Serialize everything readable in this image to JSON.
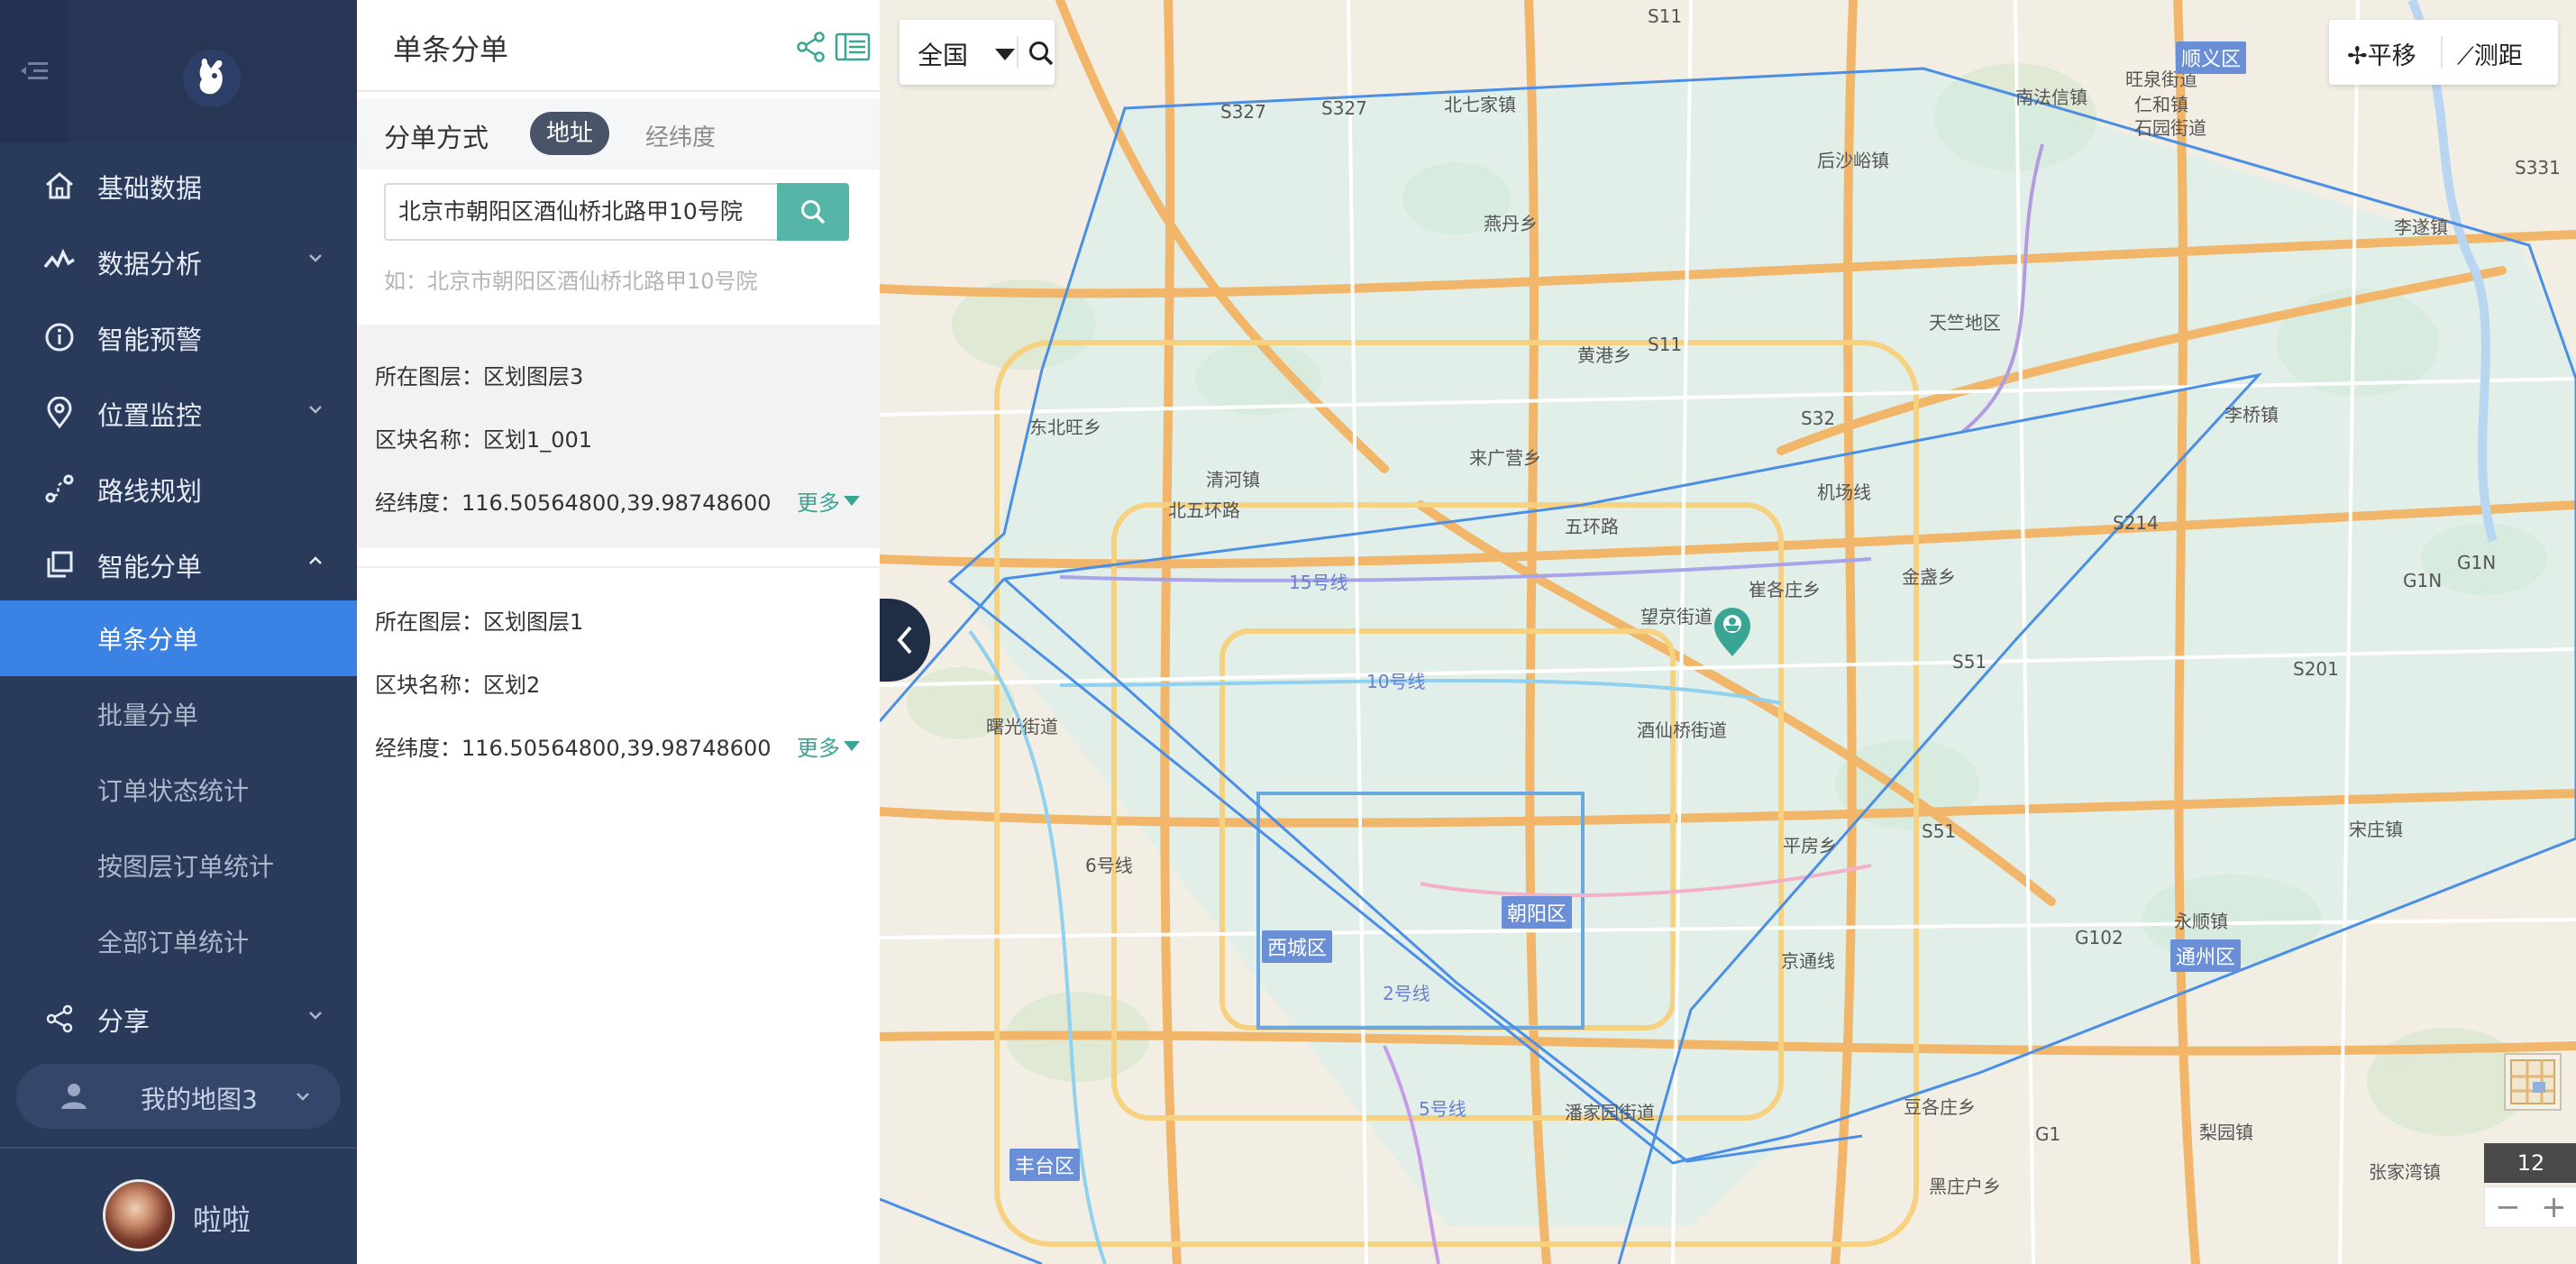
{
  "sidebar": {
    "nav": [
      {
        "label": "基础数据"
      },
      {
        "label": "数据分析"
      },
      {
        "label": "智能预警"
      },
      {
        "label": "位置监控"
      },
      {
        "label": "路线规划"
      },
      {
        "label": "智能分单"
      }
    ],
    "sub": [
      {
        "label": "单条分单"
      },
      {
        "label": "批量分单"
      },
      {
        "label": "订单状态统计"
      },
      {
        "label": "按图层订单统计"
      },
      {
        "label": "全部订单统计"
      }
    ],
    "share": {
      "label": "分享"
    },
    "my_map": {
      "label": "我的地图3"
    },
    "user": {
      "name": "啦啦"
    },
    "active_color": "#3a82e3",
    "bg_color": "#2a3a5a"
  },
  "panel": {
    "title": "单条分单",
    "mode_label": "分单方式",
    "mode_address": "地址",
    "mode_latlng": "经纬度",
    "search_value": "北京市朝阳区酒仙桥北路甲10号院",
    "search_hint": "如：北京市朝阳区酒仙桥北路甲10号院",
    "accent_color": "#55b5a6",
    "results": [
      {
        "layer": "所在图层：区划图层3",
        "block": "区块名称：区划1_001",
        "coords": "经纬度：116.50564800,39.98748600",
        "more": "更多"
      },
      {
        "layer": "所在图层：区划图层1",
        "block": "区块名称：区划2",
        "coords": "经纬度：116.50564800,39.98748600",
        "more": "更多"
      }
    ]
  },
  "map": {
    "region": "全国",
    "pan": "平移",
    "measure": "测距",
    "zoom_level": "12",
    "zoom_out": "−",
    "zoom_in": "+",
    "labels": [
      "北七家镇",
      "南法信镇",
      "旺泉街道",
      "顺义区",
      "仁和镇",
      "石园街道",
      "李遂镇",
      "后沙峪镇",
      "燕丹乡",
      "天竺地区",
      "黄港乡",
      "东北旺乡",
      "清河镇",
      "来广营乡",
      "李桥镇",
      "金盏乡",
      "崔各庄乡",
      "望京街道",
      "酒仙桥街道",
      "曙光街道",
      "平房乡",
      "宋庄镇",
      "永顺镇",
      "通州区",
      "朝阳区",
      "西城区",
      "豆各庄乡",
      "潘家园街道",
      "梨园镇",
      "黑庄户乡",
      "张家湾镇",
      "丰台区"
    ],
    "road_labels": [
      "S11",
      "S327",
      "S327",
      "S331",
      "S32",
      "S11",
      "S214",
      "G1N",
      "G1N",
      "S51",
      "S201",
      "S51",
      "G102",
      "G1",
      "15号线",
      "10号线",
      "5号线",
      "2号线",
      "五环路",
      "机场线",
      "北五环路",
      "6号线",
      "京通线"
    ],
    "polygon_color": "#4a8ee6"
  }
}
